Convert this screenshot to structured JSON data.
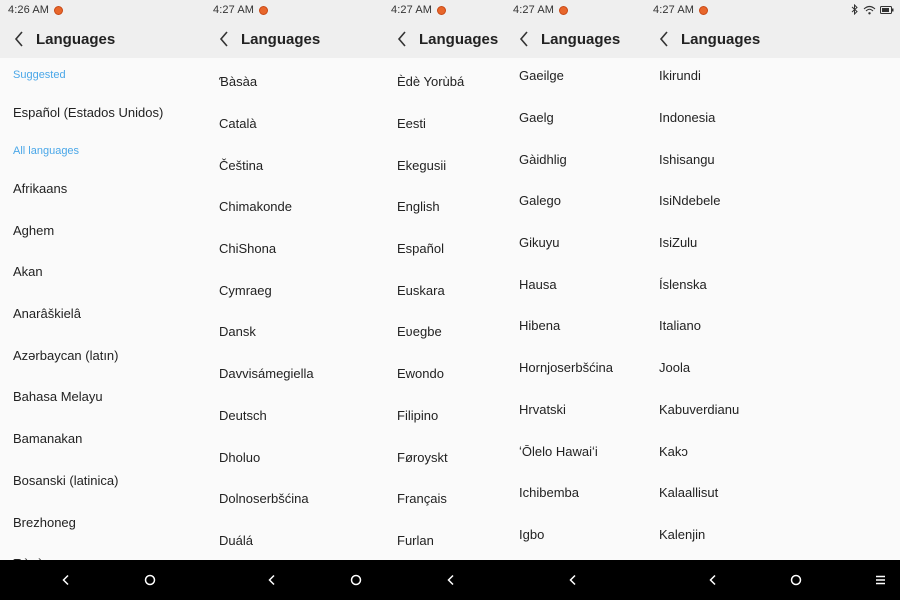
{
  "panels": [
    {
      "time": "4:26 AM",
      "title": "Languages",
      "suggested_label": "Suggested",
      "suggested_item": "Español (Estados Unidos)",
      "all_label": "All languages",
      "items": [
        "Afrikaans",
        "Aghem",
        "Akan",
        "Anarâškielâ",
        "Azərbaycan (latın)",
        "Bahasa Melayu",
        "Bamanakan",
        "Bosanski (latinica)",
        "Brezhoneg",
        "Ɓàsàa"
      ]
    },
    {
      "time": "4:27 AM",
      "title": "Languages",
      "items": [
        "Ɓàsàa",
        "Català",
        "Čeština",
        "Chimakonde",
        "ChiShona",
        "Cymraeg",
        "Dansk",
        "Davvisámegiella",
        "Deutsch",
        "Dholuo",
        "Dolnoserbšćina",
        "Duálá"
      ]
    },
    {
      "time": "4:27 AM",
      "title": "Languages",
      "items": [
        "Èdè Yorùbá",
        "Eesti",
        "Ekegusii",
        "English",
        "Español",
        "Euskara",
        "Eʋegbe",
        "Ewondo",
        "Filipino",
        "Føroyskt",
        "Français",
        "Furlan"
      ]
    },
    {
      "time": "4:27 AM",
      "title": "Languages",
      "items": [
        "Gaeilge",
        "Gaelg",
        "Gàidhlig",
        "Galego",
        "Gikuyu",
        "Hausa",
        "Hibena",
        "Hornjoserbšćina",
        "Hrvatski",
        "ʻŌlelo Hawaiʻi",
        "Ichibemba",
        "Igbo"
      ]
    },
    {
      "time": "4:27 AM",
      "title": "Languages",
      "items": [
        "Ikirundi",
        "Indonesia",
        "Ishisangu",
        "IsiNdebele",
        "IsiZulu",
        "Íslenska",
        "Italiano",
        "Joola",
        "Kabuverdianu",
        "Kakɔ",
        "Kalaallisut",
        "Kalenjin"
      ]
    }
  ],
  "colors": {
    "accent": "#4aa7e8",
    "header_bg": "#efefef",
    "list_bg": "#fafafa",
    "navbar_bg": "#000000",
    "notif": "#e8662b"
  },
  "icons": [
    "back-chevron-icon",
    "notification-icon",
    "bluetooth-icon",
    "wifi-icon",
    "battery-icon",
    "nav-back-icon",
    "nav-home-icon",
    "nav-menu-icon"
  ]
}
